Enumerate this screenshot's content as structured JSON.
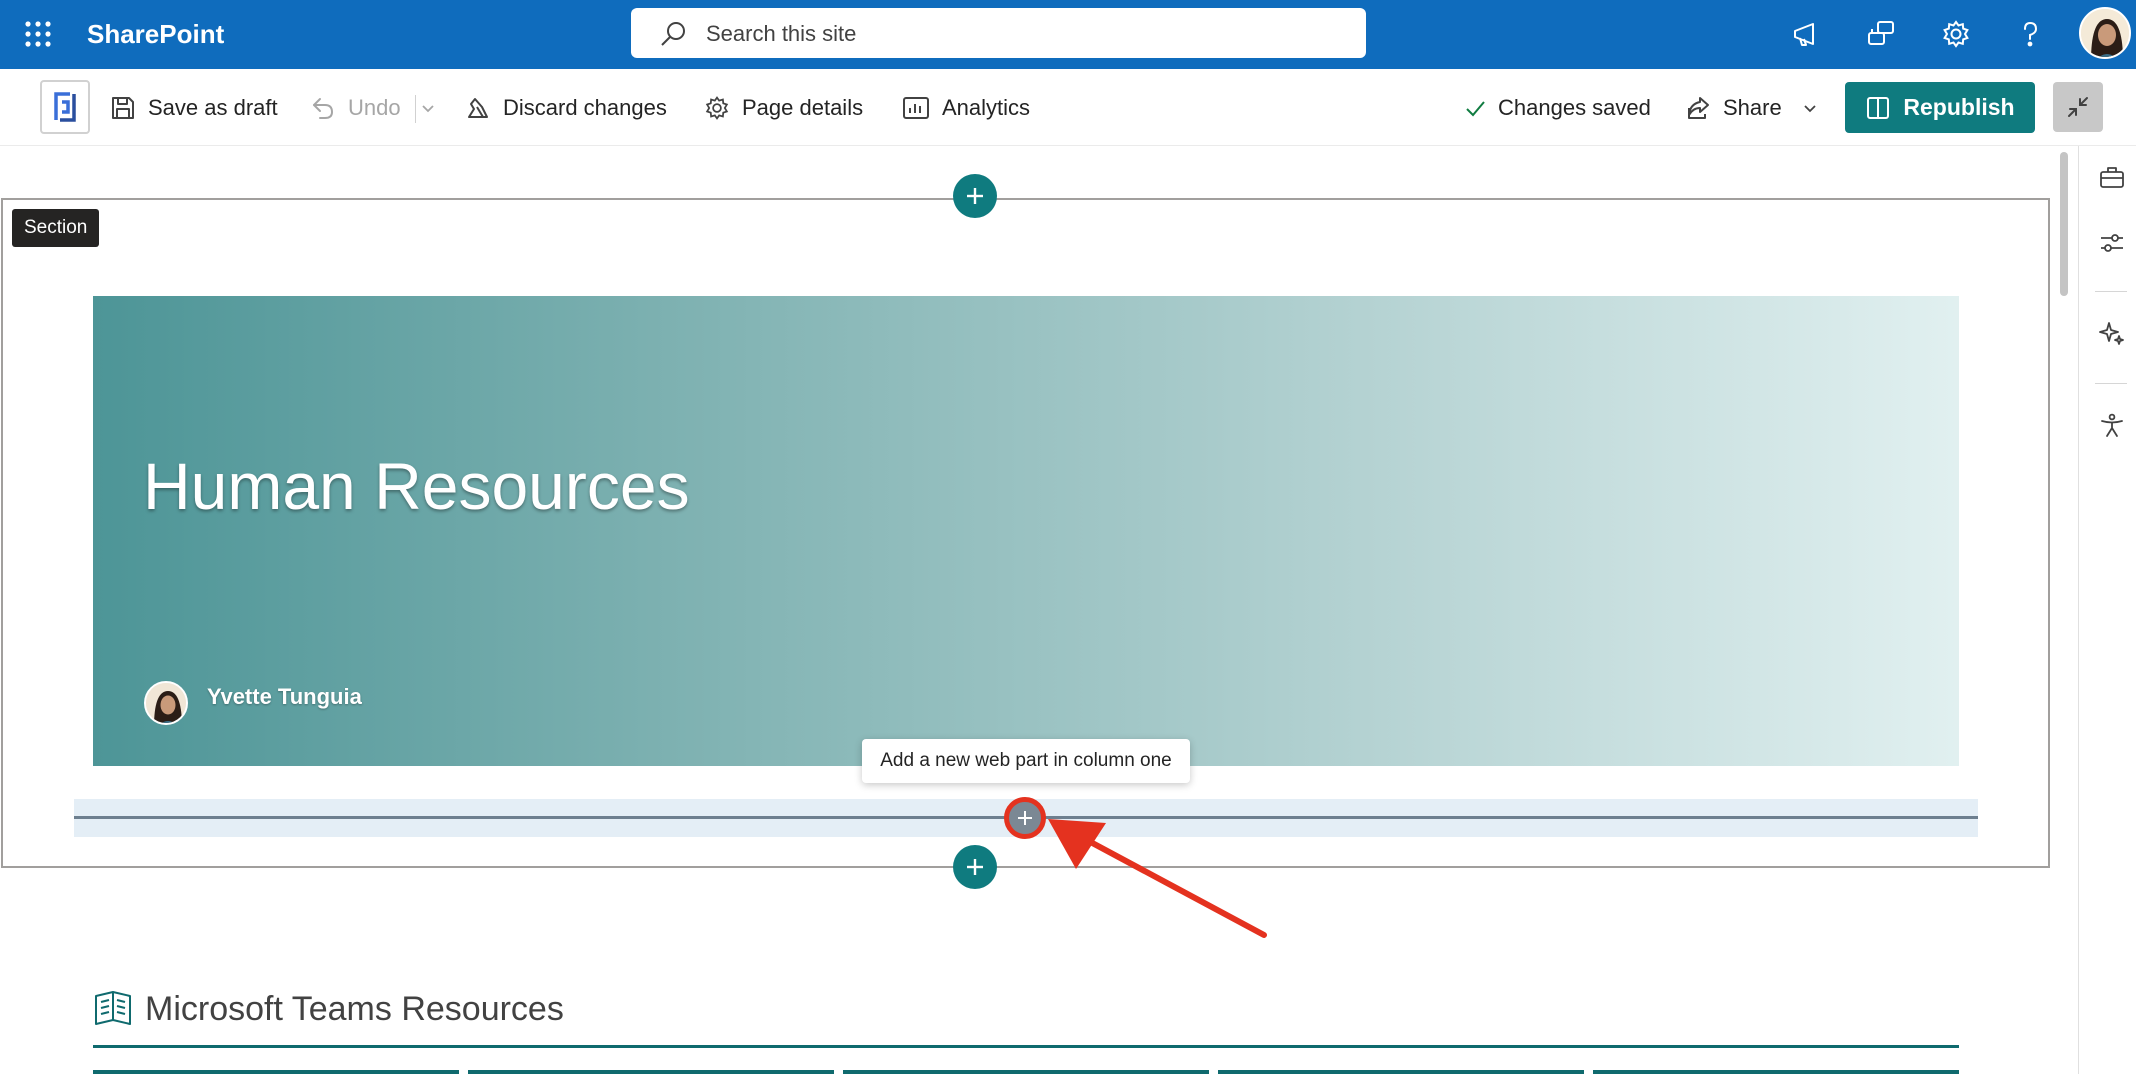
{
  "suite_bar": {
    "app_name": "SharePoint",
    "search_placeholder": "Search this site",
    "icons": [
      "waffle-icon",
      "megaphone-icon",
      "chat-bubbles-icon",
      "gear-icon",
      "help-icon",
      "avatar"
    ]
  },
  "command_bar": {
    "save_as_draft": "Save as draft",
    "undo": "Undo",
    "discard_changes": "Discard changes",
    "page_details": "Page details",
    "analytics": "Analytics",
    "status": "Changes saved",
    "share": "Share",
    "republish": "Republish"
  },
  "canvas": {
    "section_label": "Section",
    "hero": {
      "title": "Human Resources",
      "author": "Yvette Tunguia"
    },
    "tooltip": "Add a new web part in column one",
    "next_webpart_title": "Microsoft Teams Resources"
  },
  "right_rail": {
    "icons": [
      "toolbox-icon",
      "properties-sliders-icon",
      "sparkle-icon",
      "accessibility-icon"
    ]
  },
  "colors": {
    "suite_blue": "#0f6cbd",
    "teal": "#0f7b7f",
    "annotation_red": "#e4321f"
  }
}
